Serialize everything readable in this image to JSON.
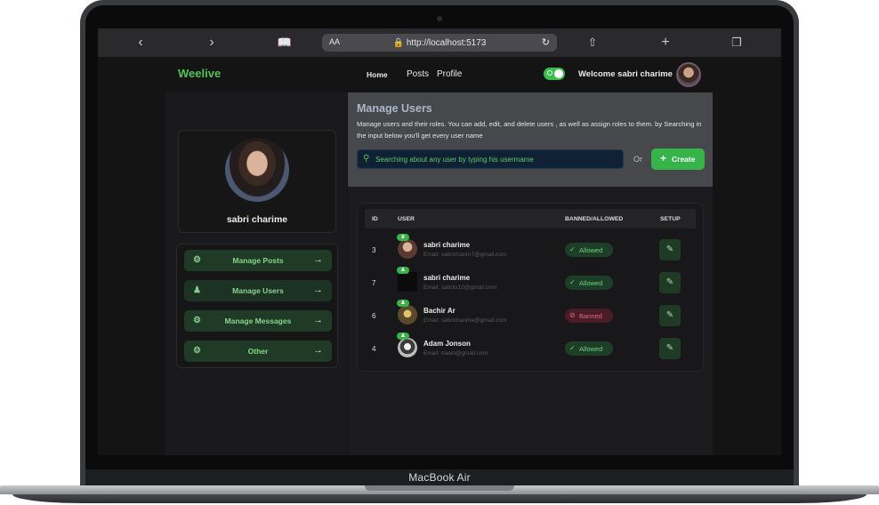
{
  "device": {
    "label": "MacBook Air"
  },
  "browser": {
    "url": "http://localhost:5173",
    "aa_label": "AA",
    "icons": [
      "back-icon",
      "forward-icon",
      "bookmarks-icon",
      "lock-icon",
      "reload-icon",
      "share-icon",
      "new-tab-icon",
      "tabs-icon"
    ]
  },
  "header": {
    "brand": "Weelive",
    "nav": [
      "Home",
      "Posts",
      "Profile"
    ],
    "welcome": "Welcome sabri charime",
    "theme_toggle": "on"
  },
  "sidebar": {
    "profile_name": "sabri charime",
    "items": [
      {
        "label": "Manage Posts",
        "icon": "gear-icon"
      },
      {
        "label": "Manage Users",
        "icon": "users-icon"
      },
      {
        "label": "Manage Messages",
        "icon": "gear-icon"
      },
      {
        "label": "Other",
        "icon": "gear-icon"
      }
    ]
  },
  "main": {
    "title": "Manage Users",
    "description": "Manage users and their roles. You can add, edit, and delete users , as well as assign roles to them. by Searching in the input below you'll get every user name",
    "search_placeholder": "Searching about any user by typing  his usermame",
    "or_label": "Or",
    "create_label": "Create",
    "table": {
      "headers": [
        "ID",
        "USER",
        "BANNED/ALLOWED",
        "SETUP"
      ],
      "rows": [
        {
          "id": "3",
          "name": "sabri charime",
          "email": "Email: sabricharim7@gmail.com",
          "status": "Allowed",
          "avatar_color": "#8a5a4a"
        },
        {
          "id": "7",
          "name": "sabri charime",
          "email": "Email: sabrilx10@gmail.com",
          "status": "Allowed",
          "avatar_color": "#0b0b0b"
        },
        {
          "id": "6",
          "name": "Bachir Ar",
          "email": "Email: sabricharime@gmail.com",
          "status": "Banned",
          "avatar_color": "#8c7a3a"
        },
        {
          "id": "4",
          "name": "Adam Jonson",
          "email": "Email: naaio@gmail.com",
          "status": "Allowed",
          "avatar_color": "#cfcfcf"
        }
      ]
    }
  },
  "colors": {
    "accent": "#35b44a",
    "brand": "#4ec45a",
    "banned": "#e06a80"
  }
}
